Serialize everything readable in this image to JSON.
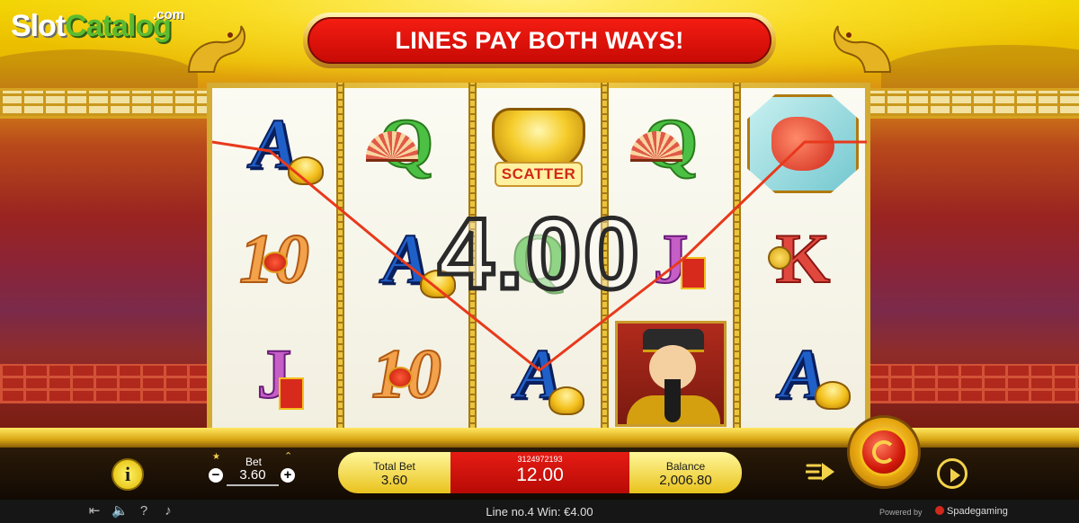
{
  "logo": {
    "part1": "Slot",
    "part2": "Catalog",
    "suffix": ".com"
  },
  "banner": {
    "text": "LINES PAY BOTH WAYS!"
  },
  "reels": [
    [
      "A",
      "10",
      "J"
    ],
    [
      "Q",
      "A",
      "10"
    ],
    [
      "SCATTER",
      "Q",
      "A"
    ],
    [
      "Q",
      "J",
      "GOD"
    ],
    [
      "DRAGON",
      "K",
      "A"
    ]
  ],
  "scatter_label": "SCATTER",
  "win_amount": "4.00",
  "controls": {
    "info_label": "i",
    "bet_label": "Bet",
    "bet_value": "3.60",
    "total_bet_label": "Total Bet",
    "total_bet_value": "3.60",
    "round_id": "3124972193",
    "win_value": "12.00",
    "balance_label": "Balance",
    "balance_value": "2,006.80"
  },
  "status": {
    "line_text": "Line no.4  Win: €4.00",
    "powered_by": "Powered by",
    "provider": "Spadegaming"
  },
  "colors": {
    "accent_gold": "#f3c01b",
    "banner_red": "#e41a12",
    "win_line": "#e8391c",
    "bar_dark": "#120a03"
  }
}
